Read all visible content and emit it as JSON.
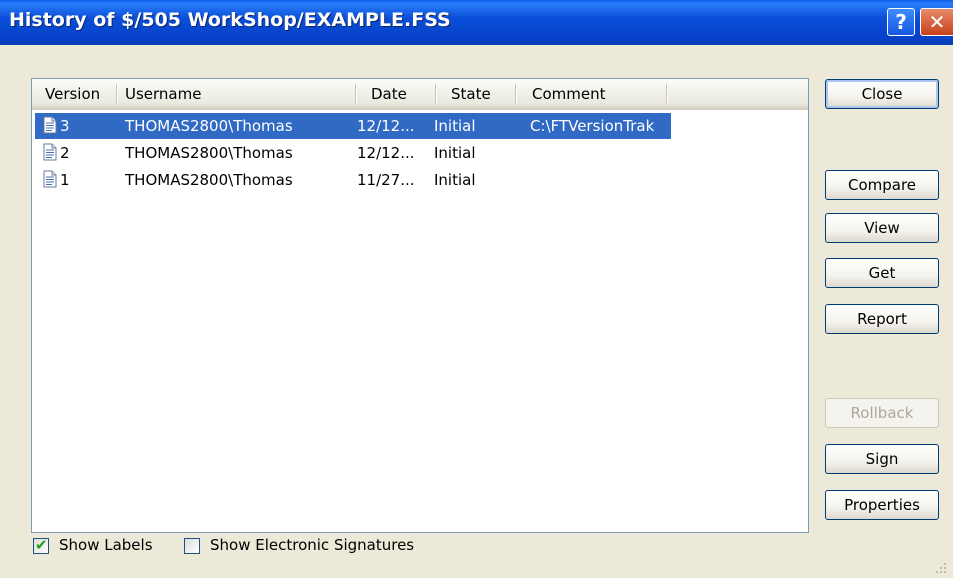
{
  "window": {
    "title": "History of $/505 WorkShop/EXAMPLE.FSS",
    "help_glyph": "?",
    "close_glyph": "✕"
  },
  "list": {
    "columns": [
      "Version",
      "Username",
      "Date",
      "State",
      "Comment"
    ],
    "rows": [
      {
        "version": "3",
        "username": "THOMAS2800\\Thomas",
        "date": "12/12...",
        "state": "Initial",
        "comment": "C:\\FTVersionTrak",
        "selected": true
      },
      {
        "version": "2",
        "username": "THOMAS2800\\Thomas",
        "date": "12/12...",
        "state": "Initial",
        "comment": "",
        "selected": false
      },
      {
        "version": "1",
        "username": "THOMAS2800\\Thomas",
        "date": "11/27...",
        "state": "Initial",
        "comment": "",
        "selected": false
      }
    ]
  },
  "buttons": {
    "close": "Close",
    "compare": "Compare",
    "view": "View",
    "get": "Get",
    "report": "Report",
    "rollback": "Rollback",
    "sign": "Sign",
    "properties": "Properties"
  },
  "checkboxes": {
    "show_labels": {
      "label": "Show Labels",
      "checked": true
    },
    "show_signatures": {
      "label": "Show Electronic Signatures",
      "checked": false
    }
  },
  "colors": {
    "selection": "#316ac5",
    "titlebar": "#0a4fd8",
    "dialog_bg": "#ece9d8"
  },
  "icons": {
    "row_icon": "document-icon",
    "check_glyph": "✔"
  }
}
